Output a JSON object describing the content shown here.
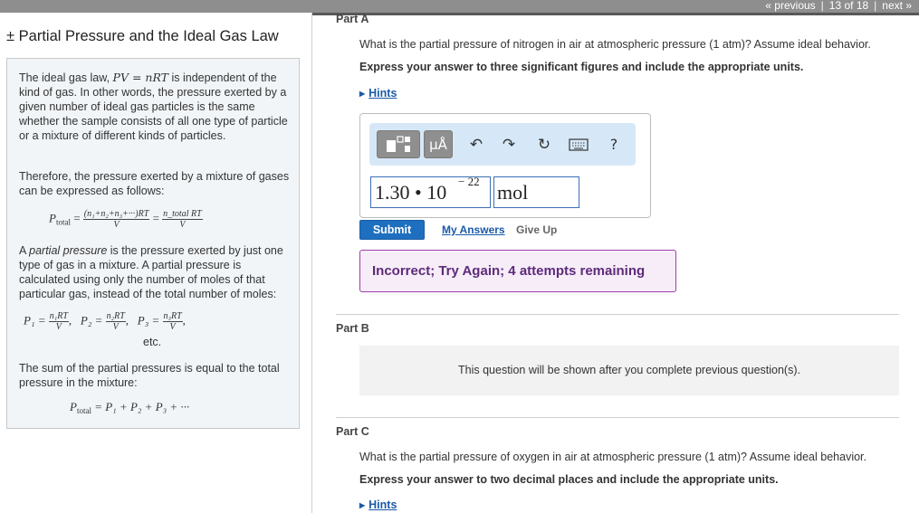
{
  "nav": {
    "previous": "« previous",
    "position": "13 of 18",
    "next": "next »"
  },
  "left": {
    "title": "± Partial Pressure and the Ideal Gas Law",
    "intro": {
      "p1_before": "The ideal gas law, ",
      "p1_eq": "PV = nRT",
      "p1_after": " is independent of the kind of gas. In other words, the pressure exerted by a given number of ideal gas particles is the same whether the sample consists of all one type of particle or a mixture of different kinds of particles.",
      "p2": "Therefore, the pressure exerted by a mixture of gases can be expressed as follows:",
      "eq1_lhs": "P",
      "eq1_lhs_sub": "total",
      "eq1_frac1_num": "(n₁+n₂+n₃+···)RT",
      "eq1_frac1_den": "V",
      "eq1_frac2_num": "n_total RT",
      "eq1_frac2_den": "V",
      "p3_a": "A ",
      "p3_em": "partial pressure",
      "p3_b": " is the pressure exerted by just one type of gas in a mixture. A partial pressure is calculated using only the number of moles of that particular gas, instead of the total number of moles:",
      "eq2_p1": "P₁ =",
      "eq2_f1_num": "n₁RT",
      "eq2_p2": "P₂ =",
      "eq2_f2_num": "n₂RT",
      "eq2_p3": "P₃ =",
      "eq2_f3_num": "n₃RT",
      "eq2_den": "V",
      "eq2_etc": "etc.",
      "p4": "The sum of the partial pressures is equal to the total pressure in the mixture:",
      "eq3_lhs": "P",
      "eq3_lhs_sub": "total",
      "eq3_rhs": "= P₁ + P₂ + P₃ + ···"
    }
  },
  "partA": {
    "label": "Part A",
    "question": "What is the partial pressure of nitrogen in air at atmospheric pressure (1 atm)? Assume ideal behavior.",
    "instruction": "Express your answer to three significant figures and include the appropriate units.",
    "hints": "Hints",
    "toolbar": {
      "units_label": "μÅ",
      "help_label": "?"
    },
    "answer_value": "1.30 • 10",
    "answer_exponent": "− 22",
    "answer_unit": "mol",
    "submit": "Submit",
    "my_answers": "My Answers",
    "give_up": "Give Up",
    "feedback": "Incorrect; Try Again; 4 attempts remaining"
  },
  "partB": {
    "label": "Part B",
    "locked": "This question will be shown after you complete previous question(s)."
  },
  "partC": {
    "label": "Part C",
    "question": "What is the partial pressure of oxygen in air at atmospheric pressure (1 atm)? Assume ideal behavior.",
    "instruction": "Express your answer to two decimal places and include the appropriate units.",
    "hints": "Hints"
  }
}
